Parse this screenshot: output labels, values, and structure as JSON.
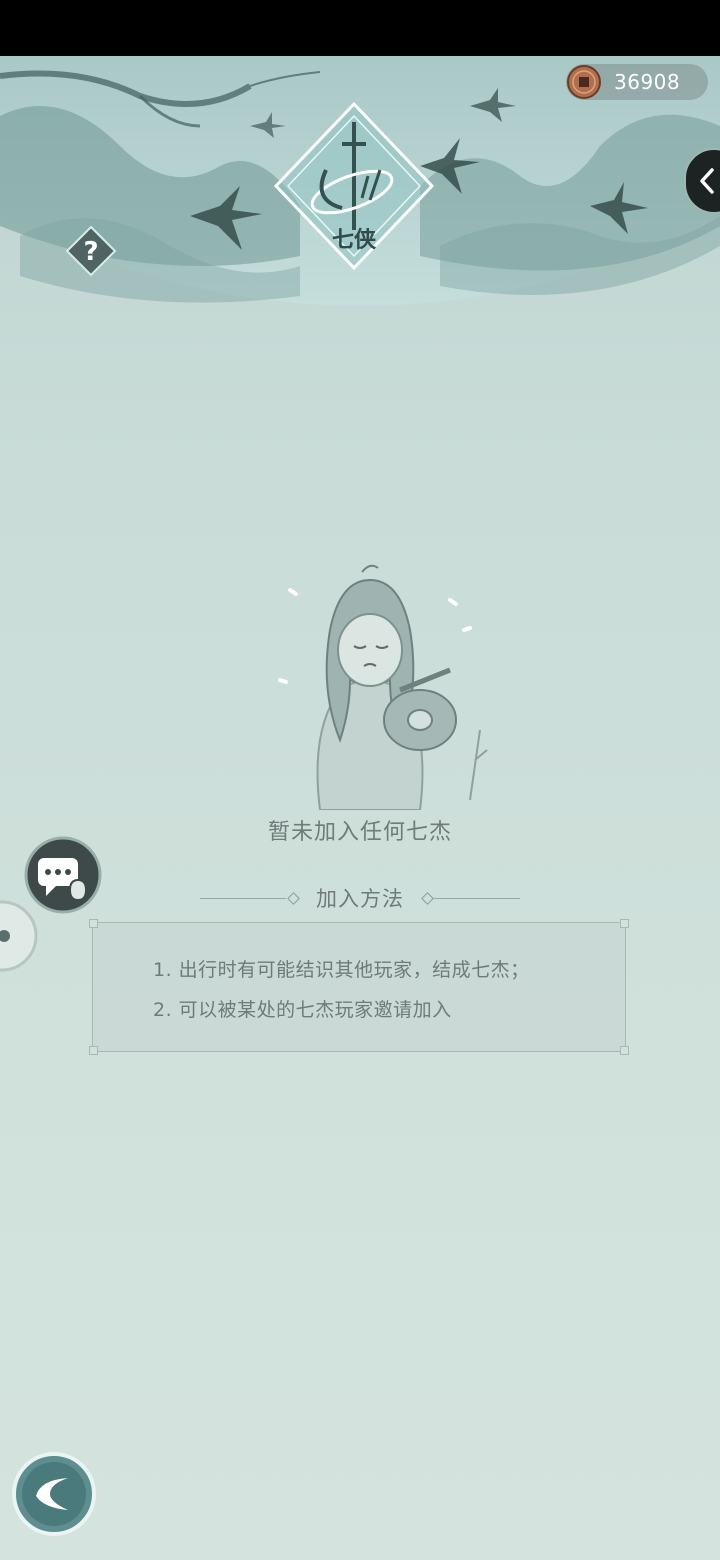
{
  "header": {
    "emblem_title": "七侠",
    "copper_coins": "36908"
  },
  "empty_state": {
    "message": "暂未加入任何七杰"
  },
  "join_method": {
    "title": "加入方法",
    "lines": [
      "1. 出行时有可能结识其他玩家，结成七杰；",
      "2. 可以被某处的七杰玩家邀请加入"
    ]
  },
  "icons": {
    "coin": "copper-coin-icon",
    "collapse": "chevron-left-icon",
    "help": "question-mark-icon",
    "chat": "chat-bubble-icon",
    "back": "back-arrow-icon"
  },
  "colors": {
    "background": "#cddfda",
    "text": "#6f7b79",
    "ink": "#3e5b5a",
    "accent": "#8fc3c3"
  }
}
